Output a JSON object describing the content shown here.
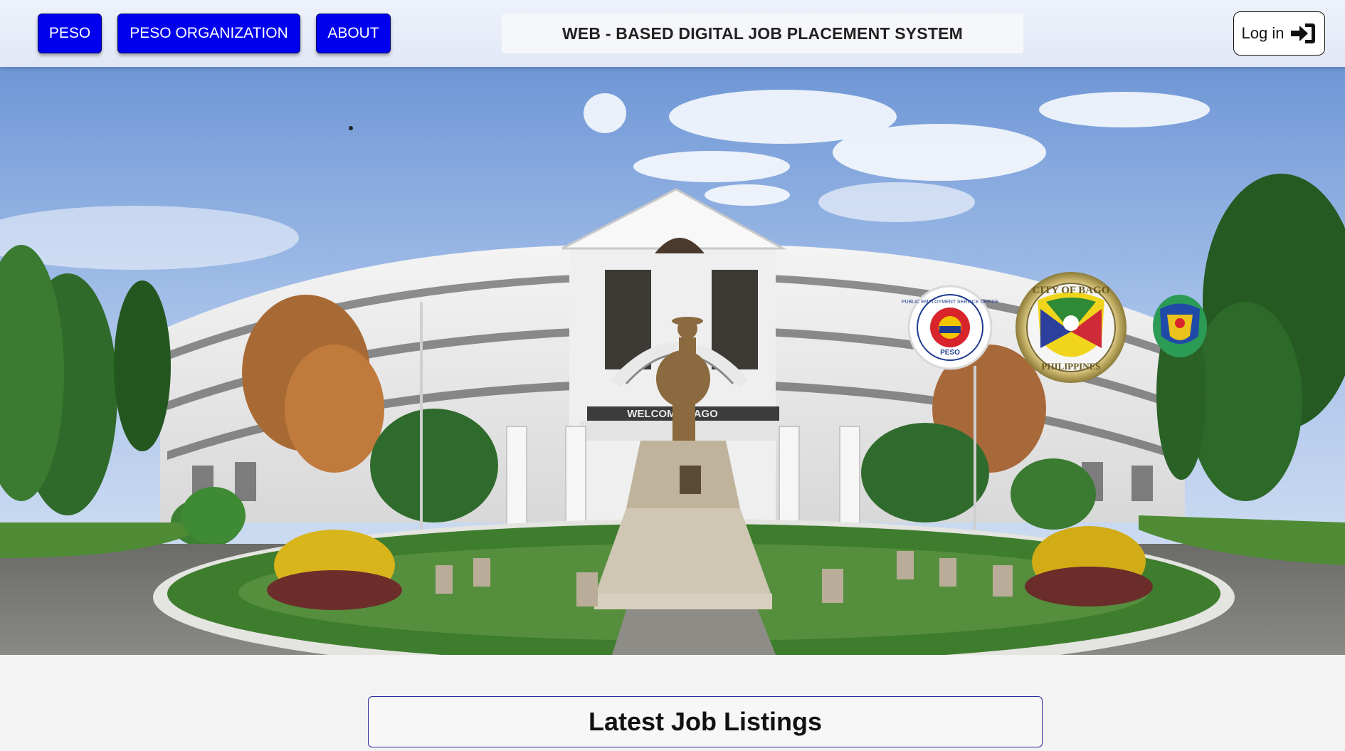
{
  "nav": {
    "peso_label": "PESO",
    "organization_label": "PESO ORGANIZATION",
    "about_label": "ABOUT"
  },
  "header": {
    "system_title": "WEB - BASED DIGITAL JOB PLACEMENT SYSTEM",
    "login_label": "Log in",
    "login_icon": "sign-in-icon"
  },
  "hero": {
    "banner_text": "WELCOME BAGO",
    "seals": [
      {
        "name": "peso-seal",
        "ring_text": "PUBLIC EMPLOYMENT SERVICE OFFICE",
        "inner_text": "PESO"
      },
      {
        "name": "city-of-bago-seal",
        "top_text": "CITY OF BAGO",
        "bottom_text": "PHILIPPINES"
      },
      {
        "name": "provincial-seal"
      }
    ]
  },
  "listings": {
    "heading": "Latest Job Listings"
  },
  "colors": {
    "nav_button": "#0000ee",
    "header_background": "#e5eaf7",
    "page_background": "#f3f3f3",
    "listing_border": "#2a2a9a"
  }
}
